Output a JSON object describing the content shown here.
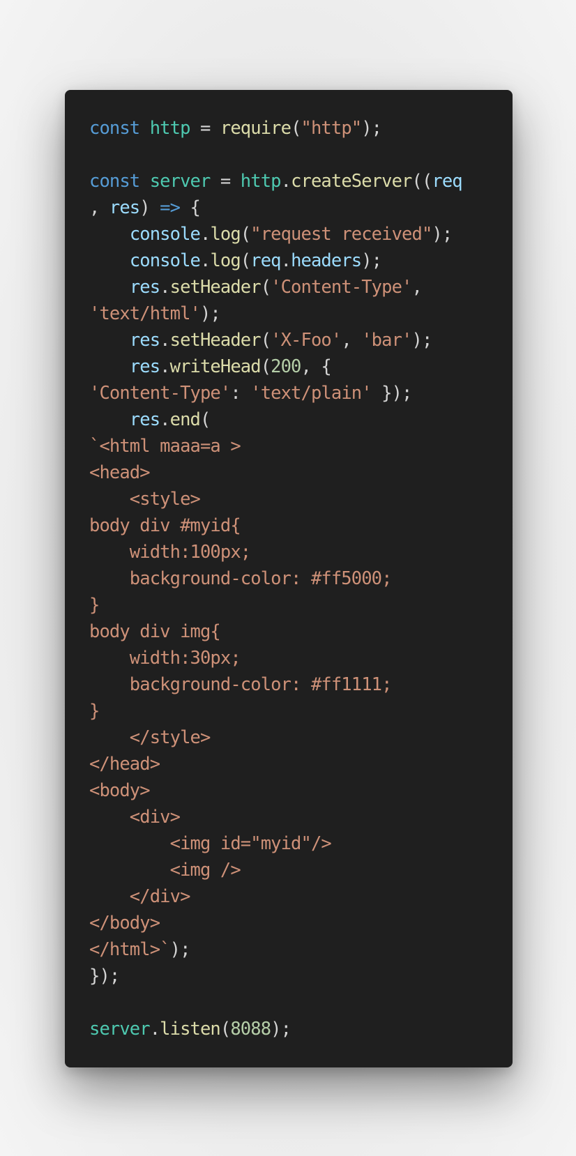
{
  "colors": {
    "page_background": "#ececec",
    "card_background": "#1f1f1f",
    "keyword": "#569cd6",
    "definition": "#4ec9b0",
    "function": "#dcdcaa",
    "string": "#ce9178",
    "number": "#b5cea8",
    "property": "#9cdcfe",
    "punctuation": "#d4d4d4"
  },
  "code_lines": [
    [
      {
        "t": "const",
        "c": "kw"
      },
      {
        "t": " ",
        "c": "pun"
      },
      {
        "t": "http",
        "c": "def"
      },
      {
        "t": " = ",
        "c": "pun"
      },
      {
        "t": "require",
        "c": "fn"
      },
      {
        "t": "(",
        "c": "pun"
      },
      {
        "t": "\"http\"",
        "c": "str"
      },
      {
        "t": ");",
        "c": "pun"
      }
    ],
    [],
    [
      {
        "t": "const",
        "c": "kw"
      },
      {
        "t": " ",
        "c": "pun"
      },
      {
        "t": "server",
        "c": "def"
      },
      {
        "t": " = ",
        "c": "pun"
      },
      {
        "t": "http",
        "c": "def"
      },
      {
        "t": ".",
        "c": "pun"
      },
      {
        "t": "createServer",
        "c": "fn"
      },
      {
        "t": "((",
        "c": "pun"
      },
      {
        "t": "req",
        "c": "prop"
      }
    ],
    [
      {
        "t": ", ",
        "c": "pun"
      },
      {
        "t": "res",
        "c": "prop"
      },
      {
        "t": ") ",
        "c": "pun"
      },
      {
        "t": "=>",
        "c": "kw"
      },
      {
        "t": " {",
        "c": "pun"
      }
    ],
    [
      {
        "t": "    ",
        "c": "pun"
      },
      {
        "t": "console",
        "c": "prop"
      },
      {
        "t": ".",
        "c": "pun"
      },
      {
        "t": "log",
        "c": "fn"
      },
      {
        "t": "(",
        "c": "pun"
      },
      {
        "t": "\"request received\"",
        "c": "str"
      },
      {
        "t": ");",
        "c": "pun"
      }
    ],
    [
      {
        "t": "    ",
        "c": "pun"
      },
      {
        "t": "console",
        "c": "prop"
      },
      {
        "t": ".",
        "c": "pun"
      },
      {
        "t": "log",
        "c": "fn"
      },
      {
        "t": "(",
        "c": "pun"
      },
      {
        "t": "req",
        "c": "prop"
      },
      {
        "t": ".",
        "c": "pun"
      },
      {
        "t": "headers",
        "c": "prop"
      },
      {
        "t": ");",
        "c": "pun"
      }
    ],
    [
      {
        "t": "    ",
        "c": "pun"
      },
      {
        "t": "res",
        "c": "prop"
      },
      {
        "t": ".",
        "c": "pun"
      },
      {
        "t": "setHeader",
        "c": "fn"
      },
      {
        "t": "(",
        "c": "pun"
      },
      {
        "t": "'Content-Type'",
        "c": "str"
      },
      {
        "t": ",",
        "c": "pun"
      }
    ],
    [
      {
        "t": "'text/html'",
        "c": "str"
      },
      {
        "t": ");",
        "c": "pun"
      }
    ],
    [
      {
        "t": "    ",
        "c": "pun"
      },
      {
        "t": "res",
        "c": "prop"
      },
      {
        "t": ".",
        "c": "pun"
      },
      {
        "t": "setHeader",
        "c": "fn"
      },
      {
        "t": "(",
        "c": "pun"
      },
      {
        "t": "'X-Foo'",
        "c": "str"
      },
      {
        "t": ", ",
        "c": "pun"
      },
      {
        "t": "'bar'",
        "c": "str"
      },
      {
        "t": ");",
        "c": "pun"
      }
    ],
    [
      {
        "t": "    ",
        "c": "pun"
      },
      {
        "t": "res",
        "c": "prop"
      },
      {
        "t": ".",
        "c": "pun"
      },
      {
        "t": "writeHead",
        "c": "fn"
      },
      {
        "t": "(",
        "c": "pun"
      },
      {
        "t": "200",
        "c": "num"
      },
      {
        "t": ", {",
        "c": "pun"
      }
    ],
    [
      {
        "t": "'Content-Type'",
        "c": "str"
      },
      {
        "t": ": ",
        "c": "pun"
      },
      {
        "t": "'text/plain'",
        "c": "str"
      },
      {
        "t": " });",
        "c": "pun"
      }
    ],
    [
      {
        "t": "    ",
        "c": "pun"
      },
      {
        "t": "res",
        "c": "prop"
      },
      {
        "t": ".",
        "c": "pun"
      },
      {
        "t": "end",
        "c": "fn"
      },
      {
        "t": "(",
        "c": "pun"
      }
    ],
    [
      {
        "t": "`<html maaa=a >",
        "c": "str"
      }
    ],
    [
      {
        "t": "<head>",
        "c": "str"
      }
    ],
    [
      {
        "t": "    <style>",
        "c": "str"
      }
    ],
    [
      {
        "t": "body div #myid{",
        "c": "str"
      }
    ],
    [
      {
        "t": "    width:100px;",
        "c": "str"
      }
    ],
    [
      {
        "t": "    background-color: #ff5000;",
        "c": "str"
      }
    ],
    [
      {
        "t": "}",
        "c": "str"
      }
    ],
    [
      {
        "t": "body div img{",
        "c": "str"
      }
    ],
    [
      {
        "t": "    width:30px;",
        "c": "str"
      }
    ],
    [
      {
        "t": "    background-color: #ff1111;",
        "c": "str"
      }
    ],
    [
      {
        "t": "}",
        "c": "str"
      }
    ],
    [
      {
        "t": "    </style>",
        "c": "str"
      }
    ],
    [
      {
        "t": "</head>",
        "c": "str"
      }
    ],
    [
      {
        "t": "<body>",
        "c": "str"
      }
    ],
    [
      {
        "t": "    <div>",
        "c": "str"
      }
    ],
    [
      {
        "t": "        <img id=\"myid\"/>",
        "c": "str"
      }
    ],
    [
      {
        "t": "        <img />",
        "c": "str"
      }
    ],
    [
      {
        "t": "    </div>",
        "c": "str"
      }
    ],
    [
      {
        "t": "</body>",
        "c": "str"
      }
    ],
    [
      {
        "t": "</html>`",
        "c": "str"
      },
      {
        "t": ");",
        "c": "pun"
      }
    ],
    [
      {
        "t": "});",
        "c": "pun"
      }
    ],
    [],
    [
      {
        "t": "server",
        "c": "def"
      },
      {
        "t": ".",
        "c": "pun"
      },
      {
        "t": "listen",
        "c": "fn"
      },
      {
        "t": "(",
        "c": "pun"
      },
      {
        "t": "8088",
        "c": "num"
      },
      {
        "t": ");",
        "c": "pun"
      }
    ]
  ]
}
